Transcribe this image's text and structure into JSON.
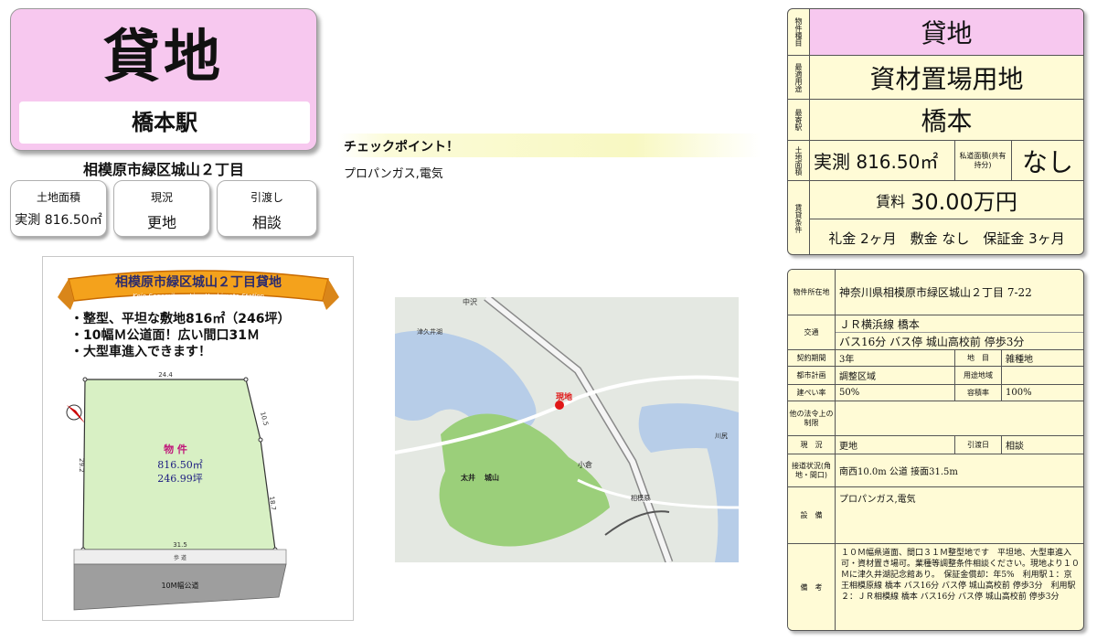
{
  "header": {
    "title": "貸地",
    "station": "橋本駅",
    "address": "相模原市緑区城山２丁目"
  },
  "summary_cards": [
    {
      "label": "土地面積",
      "value": "実測 816.50㎡"
    },
    {
      "label": "現況",
      "value": "更地"
    },
    {
      "label": "引渡し",
      "value": "相談"
    }
  ],
  "plot": {
    "banner_title": "相模原市緑区城山２丁目貸地",
    "banner_subtitle": "Keio-Sagamihara-Line Hashimoto-Station",
    "bullets": [
      "・整型、平坦な敷地816㎡（246坪）",
      "・10幅Ｍ公道面！広い間口31Ｍ",
      "・大型車進入できます！"
    ],
    "lot_label": "物 件",
    "lot_area_m2": "816.50㎡",
    "lot_area_tsubo": "246.99坪",
    "dim_top": "24.4",
    "dim_right_upper": "10.5",
    "dim_right_lower": "18.7",
    "dim_left": "29.2",
    "dim_bottom": "31.5",
    "sidewalk": "歩 道",
    "road": "10M幅公道"
  },
  "checkpoint": {
    "title": "チェックポイント！",
    "body": "プロパンガス,電気"
  },
  "map": {
    "labels": {
      "nakazawa": "中沢",
      "tsukui": "津久井湖",
      "shiroyama": "城山",
      "hashimoto": "相模原",
      "ohi": "太井",
      "genchi": "現地",
      "kura": "小倉",
      "kawashiri": "川尻"
    }
  },
  "right_top": {
    "type_label": "物件種目",
    "type_value": "貸地",
    "use_label": "最適用途",
    "use_value": "資材置場用地",
    "station_label": "最寄駅",
    "station_value": "橋本",
    "area_label": "土地面積",
    "area_value": "実測 816.50㎡",
    "private_road_label": "私道面積(共有持分)",
    "private_road_value": "なし",
    "rent_label": "賃貸条件",
    "rent_prefix": "賃料",
    "rent_value": "30.00万円",
    "terms": "礼金 2ヶ月　敷金 なし　保証金 3ヶ月"
  },
  "right_bottom": {
    "location_label": "物件所在地",
    "location_value": "神奈川県相模原市緑区城山２丁目 7-22",
    "transport_label": "交通",
    "transport_line1": "ＪＲ横浜線 橋本",
    "transport_line2": "バス16分 バス停 城山高校前 停歩3分",
    "contract_label": "契約期間",
    "contract_value": "3年",
    "chimoku_label": "地　目",
    "chimoku_value": "雑種地",
    "city_plan_label": "都市計画",
    "city_plan_value": "調整区域",
    "zone_label": "用途地域",
    "zone_value": "",
    "bcr_label": "建ぺい率",
    "bcr_value": "50%",
    "far_label": "容積率",
    "far_value": "100%",
    "other_law_label": "他の法令上の制限",
    "other_law_value": "",
    "status_label": "現　況",
    "status_value": "更地",
    "handover_label": "引渡日",
    "handover_value": "相談",
    "road_label": "接道状況(角地・間口)",
    "road_value": "南西10.0m 公道 接面31.5m",
    "facility_label": "設　備",
    "facility_value": "プロパンガス,電気",
    "remarks_label": "備　考",
    "remarks_value": "１０Ｍ幅県道面、間口３１Ｍ整型地です　平坦地、大型車進入可・資材置き場可。業種等調整条件相談ください。現地より１０Ｍに津久井湖記念館あり。　保証金償却：年5%　利用駅１：京王相模原線 橋本 バス16分 バス停 城山高校前 停歩3分　利用駅２：ＪＲ相模線 橋本 バス16分 バス停 城山高校前 停歩3分"
  },
  "colors": {
    "pink": "#f7c8ef",
    "cream": "#fffbd6",
    "lot_green": "#d8f0c4"
  }
}
